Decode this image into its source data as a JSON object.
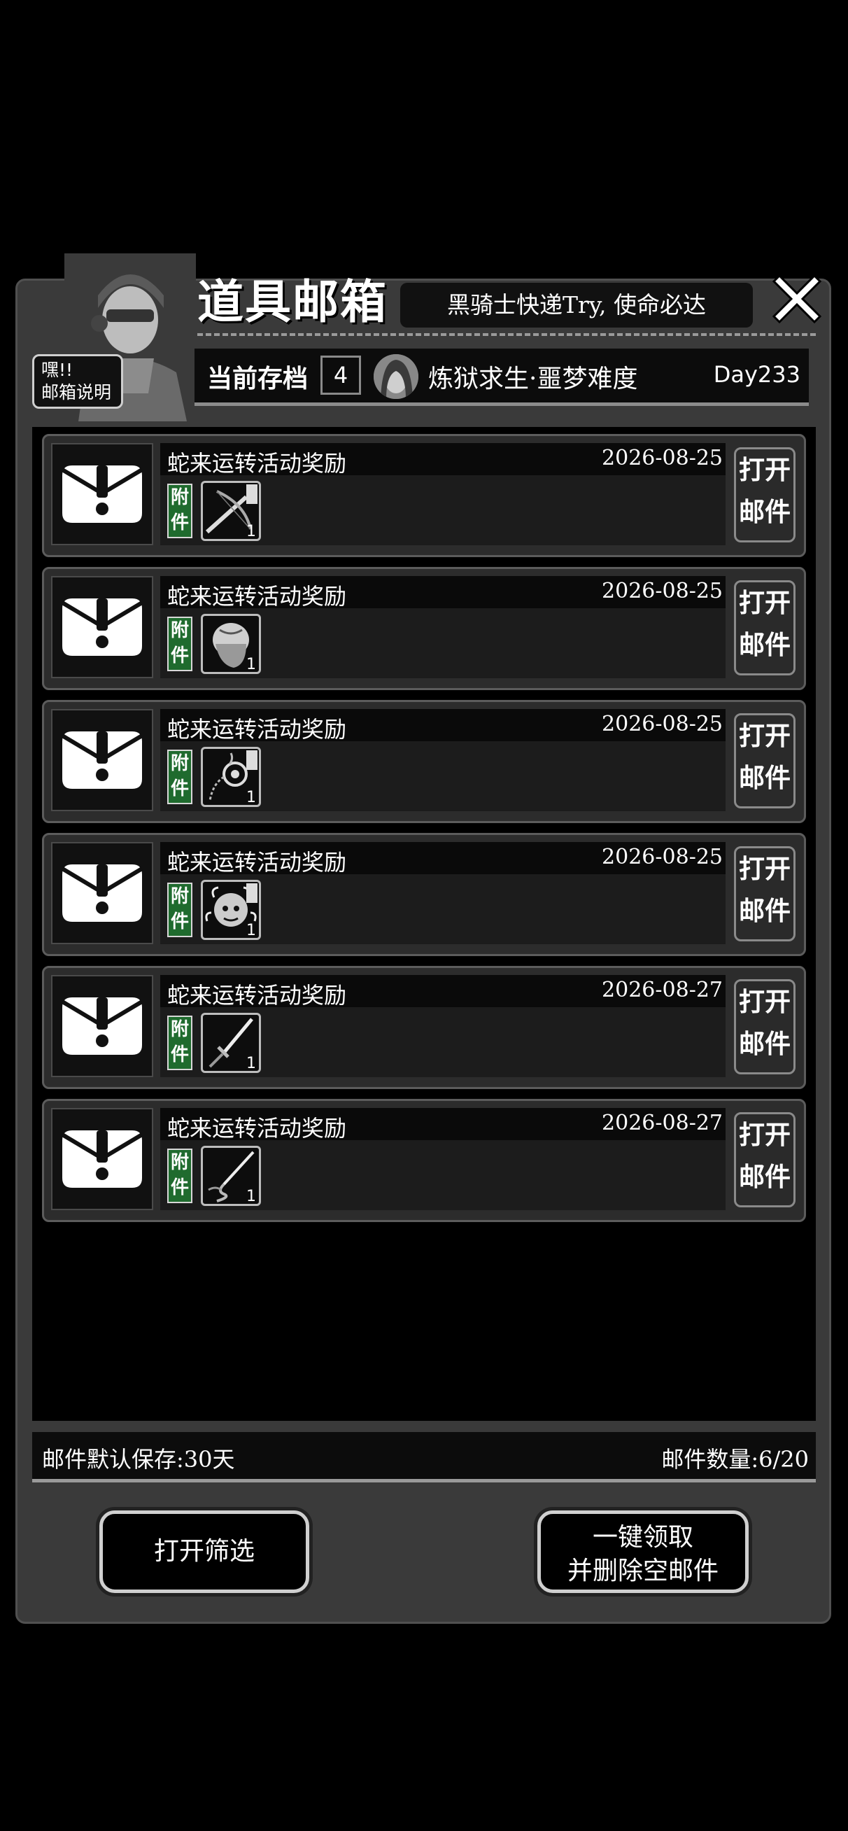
{
  "header": {
    "title": "道具邮箱",
    "slogan": "黑骑士快递Try, 使命必达",
    "help_label_line1": "嘿!!",
    "help_label_line2": "邮箱说明"
  },
  "save": {
    "label": "当前存档",
    "number": "4",
    "mode": "炼狱求生·噩梦难度",
    "day": "Day233"
  },
  "mails": [
    {
      "title": "蛇来运转活动奖励",
      "date": "2026-08-25",
      "attach_label_1": "附",
      "attach_label_2": "件",
      "item_icon": "crossbow-icon",
      "qty": "1",
      "open_1": "打开",
      "open_2": "邮件"
    },
    {
      "title": "蛇来运转活动奖励",
      "date": "2026-08-25",
      "attach_label_1": "附",
      "attach_label_2": "件",
      "item_icon": "hair-icon",
      "qty": "1",
      "open_1": "打开",
      "open_2": "邮件"
    },
    {
      "title": "蛇来运转活动奖励",
      "date": "2026-08-25",
      "attach_label_1": "附",
      "attach_label_2": "件",
      "item_icon": "chain-whip-icon",
      "qty": "1",
      "open_1": "打开",
      "open_2": "邮件"
    },
    {
      "title": "蛇来运转活动奖励",
      "date": "2026-08-25",
      "attach_label_1": "附",
      "attach_label_2": "件",
      "item_icon": "medusa-icon",
      "qty": "1",
      "open_1": "打开",
      "open_2": "邮件"
    },
    {
      "title": "蛇来运转活动奖励",
      "date": "2026-08-27",
      "attach_label_1": "附",
      "attach_label_2": "件",
      "item_icon": "sword-icon",
      "qty": "1",
      "open_1": "打开",
      "open_2": "邮件"
    },
    {
      "title": "蛇来运转活动奖励",
      "date": "2026-08-27",
      "attach_label_1": "附",
      "attach_label_2": "件",
      "item_icon": "snake-blade-icon",
      "qty": "1",
      "open_1": "打开",
      "open_2": "邮件"
    }
  ],
  "footer": {
    "retention": "邮件默认保存:30天",
    "count": "邮件数量:6/20"
  },
  "buttons": {
    "filter": "打开筛选",
    "claim_line1": "一键领取",
    "claim_line2": "并删除空邮件"
  }
}
